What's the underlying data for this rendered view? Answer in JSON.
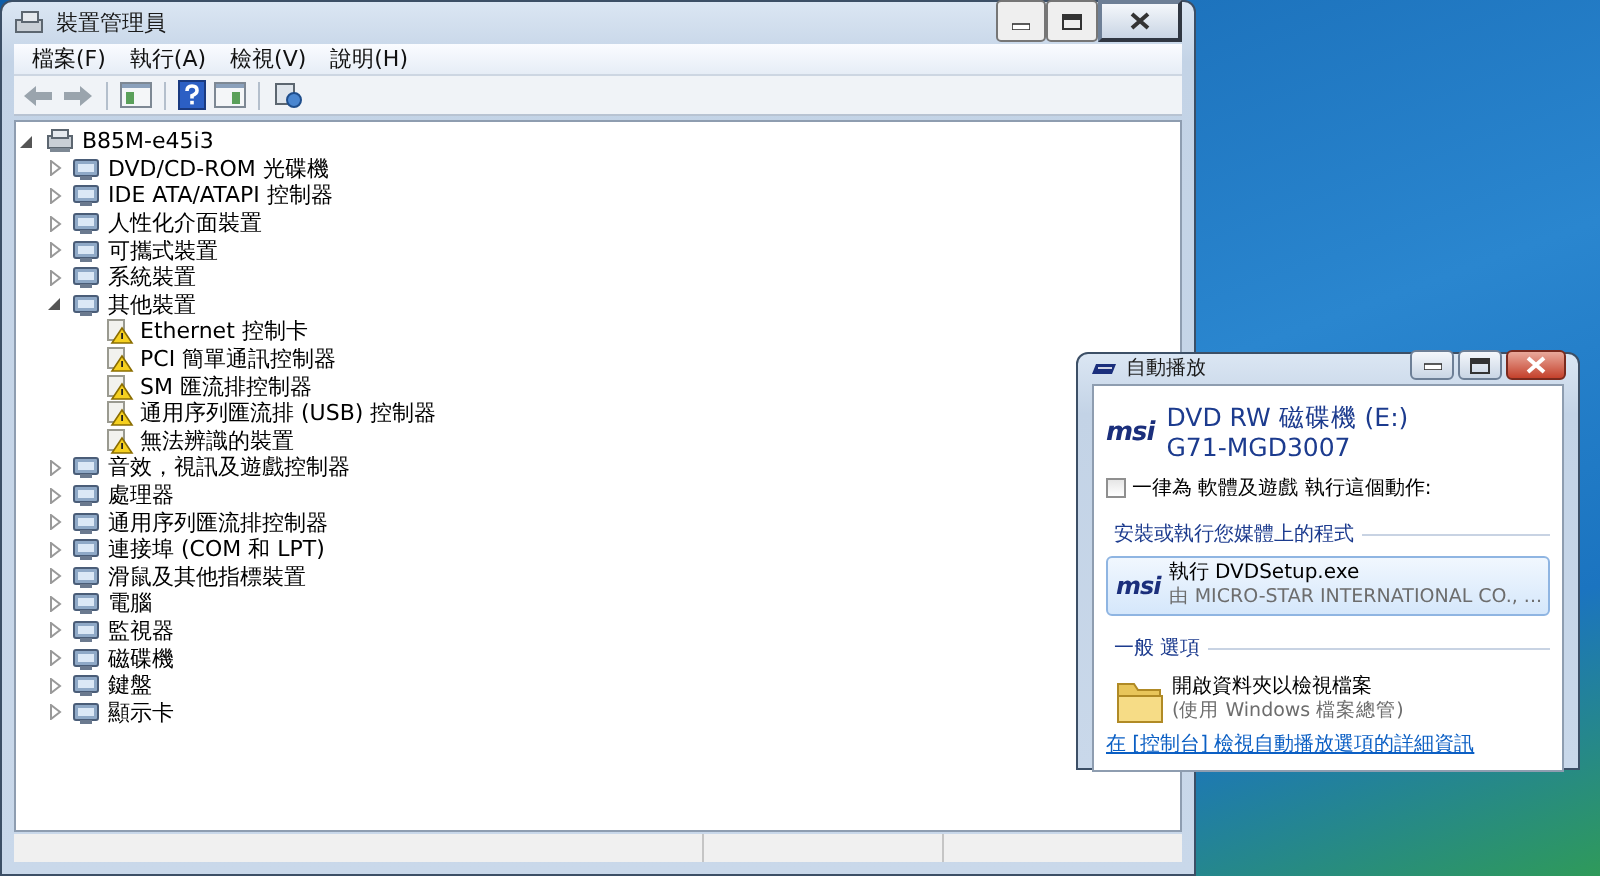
{
  "device_manager": {
    "title": "裝置管理員",
    "menu": [
      "檔案(F)",
      "執行(A)",
      "檢視(V)",
      "說明(H)"
    ],
    "tree": [
      {
        "label": "B85M-e45i3",
        "expanded": true,
        "children": [
          {
            "label": "DVD/CD-ROM 光碟機",
            "expanded": false
          },
          {
            "label": "IDE ATA/ATAPI 控制器",
            "expanded": false
          },
          {
            "label": "人性化介面裝置",
            "expanded": false
          },
          {
            "label": "可攜式裝置",
            "expanded": false
          },
          {
            "label": "系統裝置",
            "expanded": false
          },
          {
            "label": "其他裝置",
            "expanded": true,
            "children": [
              {
                "label": "Ethernet 控制卡"
              },
              {
                "label": "PCI 簡單通訊控制器"
              },
              {
                "label": "SM 匯流排控制器"
              },
              {
                "label": "通用序列匯流排 (USB) 控制器"
              },
              {
                "label": "無法辨識的裝置"
              }
            ]
          },
          {
            "label": "音效，視訊及遊戲控制器",
            "expanded": false
          },
          {
            "label": "處理器",
            "expanded": false
          },
          {
            "label": "通用序列匯流排控制器",
            "expanded": false
          },
          {
            "label": "連接埠 (COM 和 LPT)",
            "expanded": false
          },
          {
            "label": "滑鼠及其他指標裝置",
            "expanded": false
          },
          {
            "label": "電腦",
            "expanded": false
          },
          {
            "label": "監視器",
            "expanded": false
          },
          {
            "label": "磁碟機",
            "expanded": false
          },
          {
            "label": "鍵盤",
            "expanded": false
          },
          {
            "label": "顯示卡",
            "expanded": false
          }
        ]
      }
    ]
  },
  "autoplay": {
    "title": "自動播放",
    "brand": "msi",
    "device_name": "DVD RW 磁碟機 (E:)",
    "volume_label": "G71-MGD3007",
    "always_checkbox": {
      "label": "一律為 軟體及遊戲 執行這個動作:",
      "checked": false
    },
    "sections": [
      {
        "heading": "安裝或執行您媒體上的程式",
        "options": [
          {
            "kind": "brand",
            "brand": "msi",
            "title": "執行 DVDSetup.exe",
            "subtitle": "由 MICRO-STAR INTERNATIONAL CO., ...",
            "selected": true
          }
        ]
      },
      {
        "heading": "一般 選項",
        "options": [
          {
            "kind": "folder",
            "title": "開啟資料夾以檢視檔案",
            "subtitle": "(使用 Windows 檔案總管)",
            "selected": false
          }
        ]
      }
    ],
    "link": "在 [控制台] 檢視自動播放選項的詳細資訊"
  }
}
